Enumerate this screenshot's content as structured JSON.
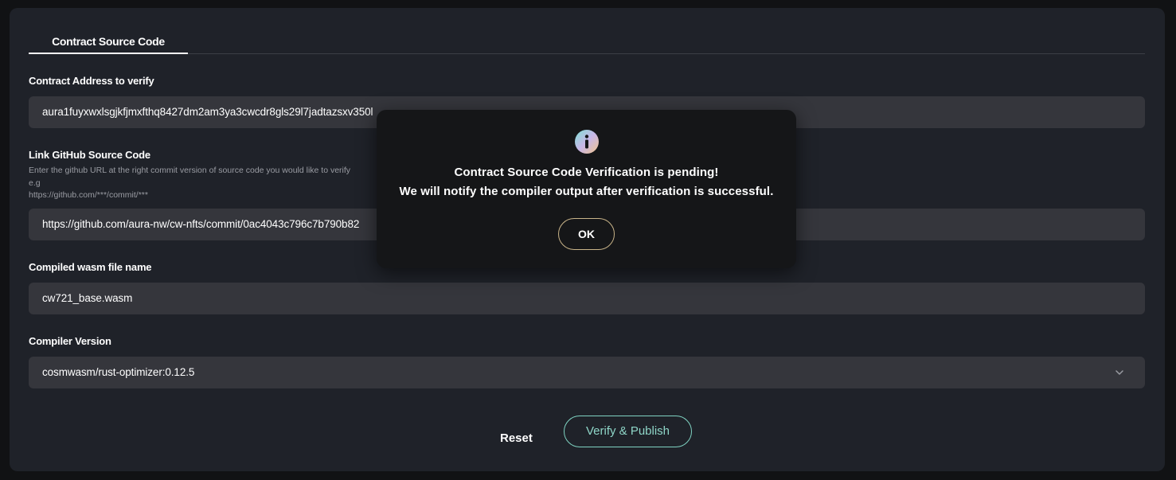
{
  "tabs": [
    {
      "label": "Contract Source Code"
    }
  ],
  "form": {
    "contract_address": {
      "label": "Contract Address to verify",
      "value": "aura1fuyxwxlsgjkfjmxfthq8427dm2am3ya3cwcdr8gls29l7jadtazsxv350l"
    },
    "github_link": {
      "label": "Link GitHub Source Code",
      "help_line1": "Enter the github URL at the right commit version of source code you would like to verify",
      "help_line2": "e.g",
      "help_line3": "https://github.com/***/commit/***",
      "value": "https://github.com/aura-nw/cw-nfts/commit/0ac4043c796c7b790b82"
    },
    "wasm_file": {
      "label": "Compiled wasm file name",
      "value": "cw721_base.wasm"
    },
    "compiler_version": {
      "label": "Compiler Version",
      "value": "cosmwasm/rust-optimizer:0.12.5"
    }
  },
  "actions": {
    "reset_label": "Reset",
    "verify_label": "Verify & Publish"
  },
  "modal": {
    "icon": "info-icon",
    "title": "Contract Source Code Verification is pending!",
    "message": "We will notify the compiler output after verification is successful.",
    "ok_label": "OK"
  },
  "colors": {
    "background": "#111214",
    "card": "#1f2229",
    "input": "#35363c",
    "accent_teal": "#7fd3c2",
    "accent_gold": "#c9b489"
  }
}
